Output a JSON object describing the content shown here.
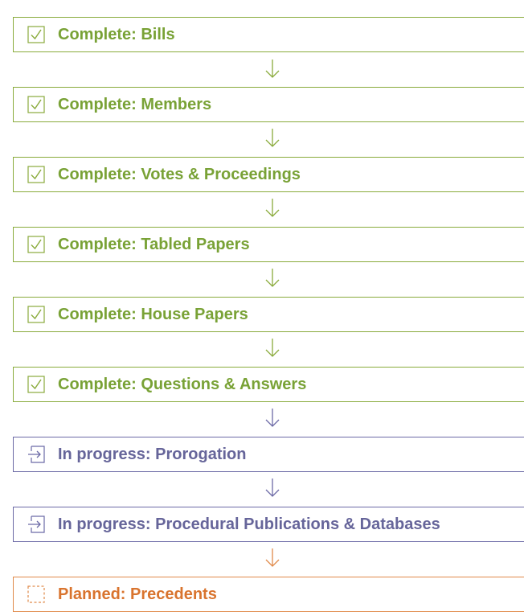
{
  "colors": {
    "complete": "#8aab3c",
    "in_progress": "#6c6aa6",
    "planned": "#e08a4a"
  },
  "steps": [
    {
      "status": "complete",
      "icon": "checkbox-checked-icon",
      "label": "Complete: Bills"
    },
    {
      "status": "complete",
      "icon": "checkbox-checked-icon",
      "label": "Complete: Members"
    },
    {
      "status": "complete",
      "icon": "checkbox-checked-icon",
      "label": "Complete: Votes & Proceedings"
    },
    {
      "status": "complete",
      "icon": "checkbox-checked-icon",
      "label": "Complete: Tabled Papers"
    },
    {
      "status": "complete",
      "icon": "checkbox-checked-icon",
      "label": "Complete: House Papers"
    },
    {
      "status": "complete",
      "icon": "checkbox-checked-icon",
      "label": "Complete: Questions & Answers"
    },
    {
      "status": "in_progress",
      "icon": "arrow-into-box-icon",
      "label": "In progress: Prorogation"
    },
    {
      "status": "in_progress",
      "icon": "arrow-into-box-icon",
      "label": "In progress: Procedural Publications & Databases"
    },
    {
      "status": "planned",
      "icon": "dashed-box-icon",
      "label": "Planned: Precedents"
    }
  ]
}
